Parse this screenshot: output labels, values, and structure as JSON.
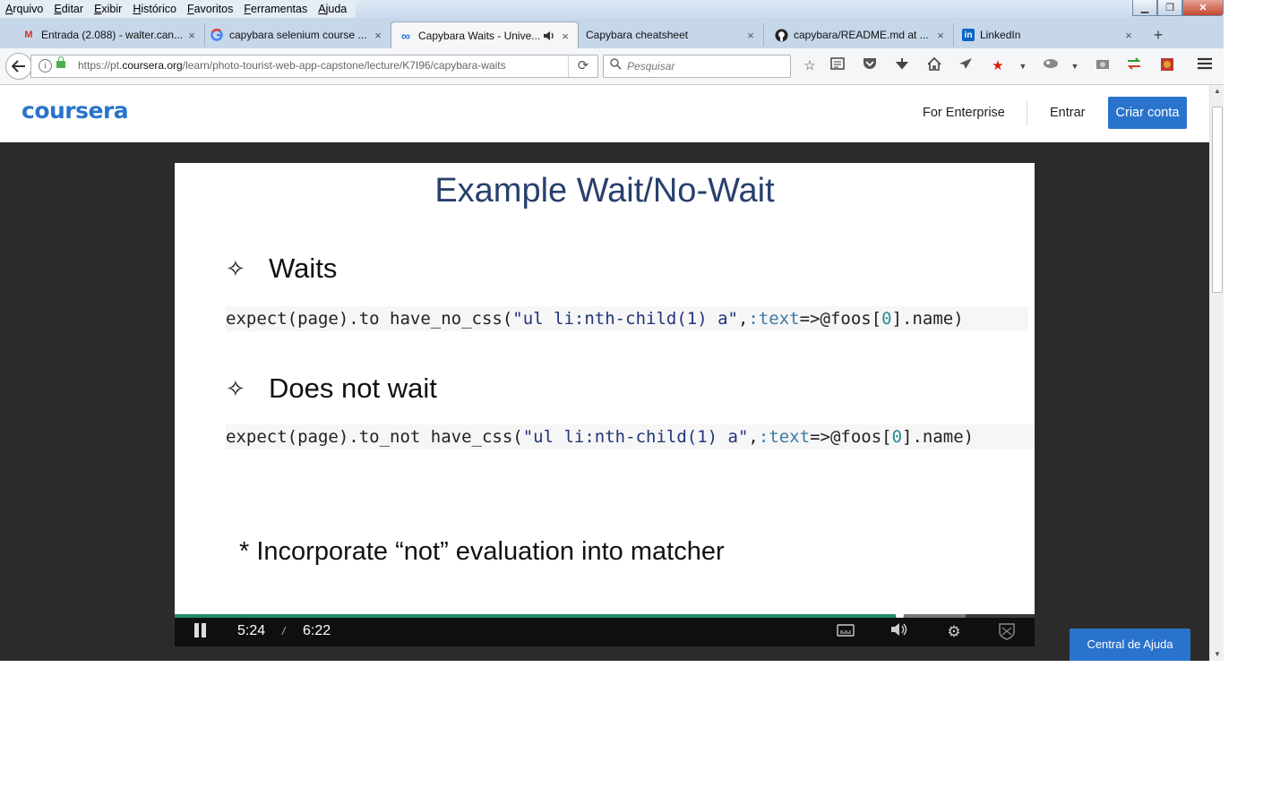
{
  "window": {
    "menus": [
      "Arquivo",
      "Editar",
      "Exibir",
      "Histórico",
      "Favoritos",
      "Ferramentas",
      "Ajuda"
    ],
    "controls": {
      "minimize": "▁",
      "restore": "❐",
      "close": "✕"
    }
  },
  "tabs": [
    {
      "title": "Entrada (2.088) - walter.can...",
      "favicon": "gmail-icon",
      "active": false
    },
    {
      "title": "capybara selenium course ...",
      "favicon": "google-icon",
      "active": false
    },
    {
      "title": "Capybara Waits - Unive...",
      "favicon": "coursera-icon",
      "active": true,
      "audio": true
    },
    {
      "title": "Capybara cheatsheet",
      "favicon": "",
      "active": false
    },
    {
      "title": "capybara/README.md at ...",
      "favicon": "github-icon",
      "active": false
    },
    {
      "title": "LinkedIn",
      "favicon": "linkedin-icon",
      "active": false
    }
  ],
  "tab_close": "×",
  "new_tab": "+",
  "nav": {
    "url_prefix": "https://pt.",
    "url_domain": "coursera.org",
    "url_path": "/learn/photo-tourist-web-app-capstone/lecture/K7I96/capybara-waits",
    "search_placeholder": "Pesquisar",
    "toolbar_icons": [
      "star-icon",
      "reader-icon",
      "pocket-icon",
      "download-icon",
      "home-icon",
      "send-icon",
      "bookmark-star-icon",
      "extension-icon",
      "screenshot-icon",
      "sync-icon",
      "addon-icon",
      "menu-icon"
    ]
  },
  "site": {
    "logo": "coursera",
    "for_enterprise": "For Enterprise",
    "login": "Entrar",
    "signup": "Criar conta",
    "help": "Central de Ajuda"
  },
  "slide": {
    "title": "Example Wait/No-Wait",
    "star": "✧",
    "bullet1": "Waits",
    "code1": {
      "a": "expect(page).to have_no_css(",
      "b": "\"ul li:nth-child(1) a\"",
      "c": ",",
      "d": ":text",
      "e": "=>@foos[",
      "f": "0",
      "g": "].name)"
    },
    "bullet2": "Does not wait",
    "code2": {
      "a": "expect(page).to_not have_css(",
      "b": "\"ul li:nth-child(1) a\"",
      "c": ",",
      "d": ":text",
      "e": "=>@foos[",
      "f": "0",
      "g": "].name)"
    },
    "note": "* Incorporate “not” evaluation into matcher"
  },
  "player": {
    "current_time": "5:24",
    "separator": "/",
    "duration": "6:22",
    "progress_fraction": 0.843,
    "buffered_fraction": 0.92,
    "icons": [
      "captions-icon",
      "volume-icon",
      "settings-icon",
      "fullscreen-icon"
    ]
  },
  "colors": {
    "brand": "#2a73cc",
    "progress": "#1f8c6a",
    "slide_title": "#28406e"
  }
}
